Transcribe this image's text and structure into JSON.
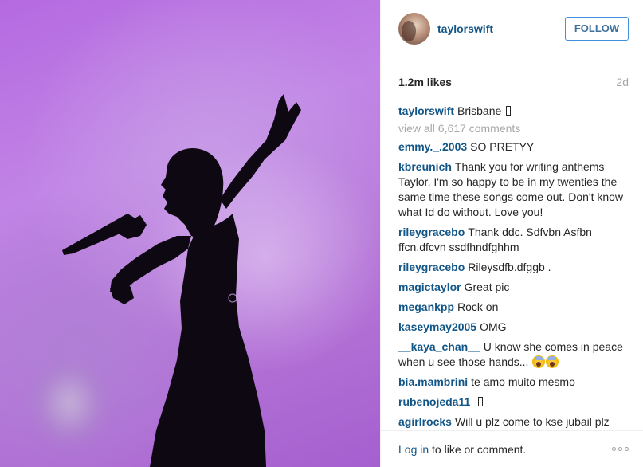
{
  "header": {
    "username": "taylorswift",
    "follow_label": "FOLLOW"
  },
  "stats": {
    "likes": "1.2m likes",
    "age": "2d"
  },
  "caption": {
    "user": "taylorswift",
    "text": "Brisbane"
  },
  "view_all": "view all 6,617 comments",
  "comments": [
    {
      "user": "emmy._.2003",
      "text": "SO PRETYY"
    },
    {
      "user": "kbreunich",
      "text": "Thank you for writing anthems Taylor. I'm so happy to be in my twenties the same time these songs come out. Don't know what Id do without. Love you!"
    },
    {
      "user": "rileygracebo",
      "text": "Thank ddc. Sdfvbn Asfbn ffcn.dfcvn ssdfhndfghhm"
    },
    {
      "user": "rileygracebo",
      "text": "Rileysdfb.dfggb ."
    },
    {
      "user": "magictaylor",
      "text": "Great pic"
    },
    {
      "user": "megankpp",
      "text": "Rock on"
    },
    {
      "user": "kaseymay2005",
      "text": "OMG"
    },
    {
      "user": "__kaya_chan__",
      "text": "U know she comes in peace when u see those hands..."
    },
    {
      "user": "bia.mambrini",
      "text": "te amo muito mesmo"
    },
    {
      "user": "rubenojeda11",
      "text": ""
    },
    {
      "user": "agirlrocks",
      "text": "Will u plz come to kse jubail plz"
    }
  ],
  "footer": {
    "login_link": "Log in",
    "login_rest": "to like or comment."
  },
  "colors": {
    "username": "#125688",
    "follow_border": "#4090db",
    "muted": "#a5a7aa",
    "photo_purple": "#b56ae0"
  },
  "icons": {
    "more": "more-options-icon",
    "box_glyph": "missing-glyph-icon",
    "emoji": "screaming-face-emoji"
  }
}
